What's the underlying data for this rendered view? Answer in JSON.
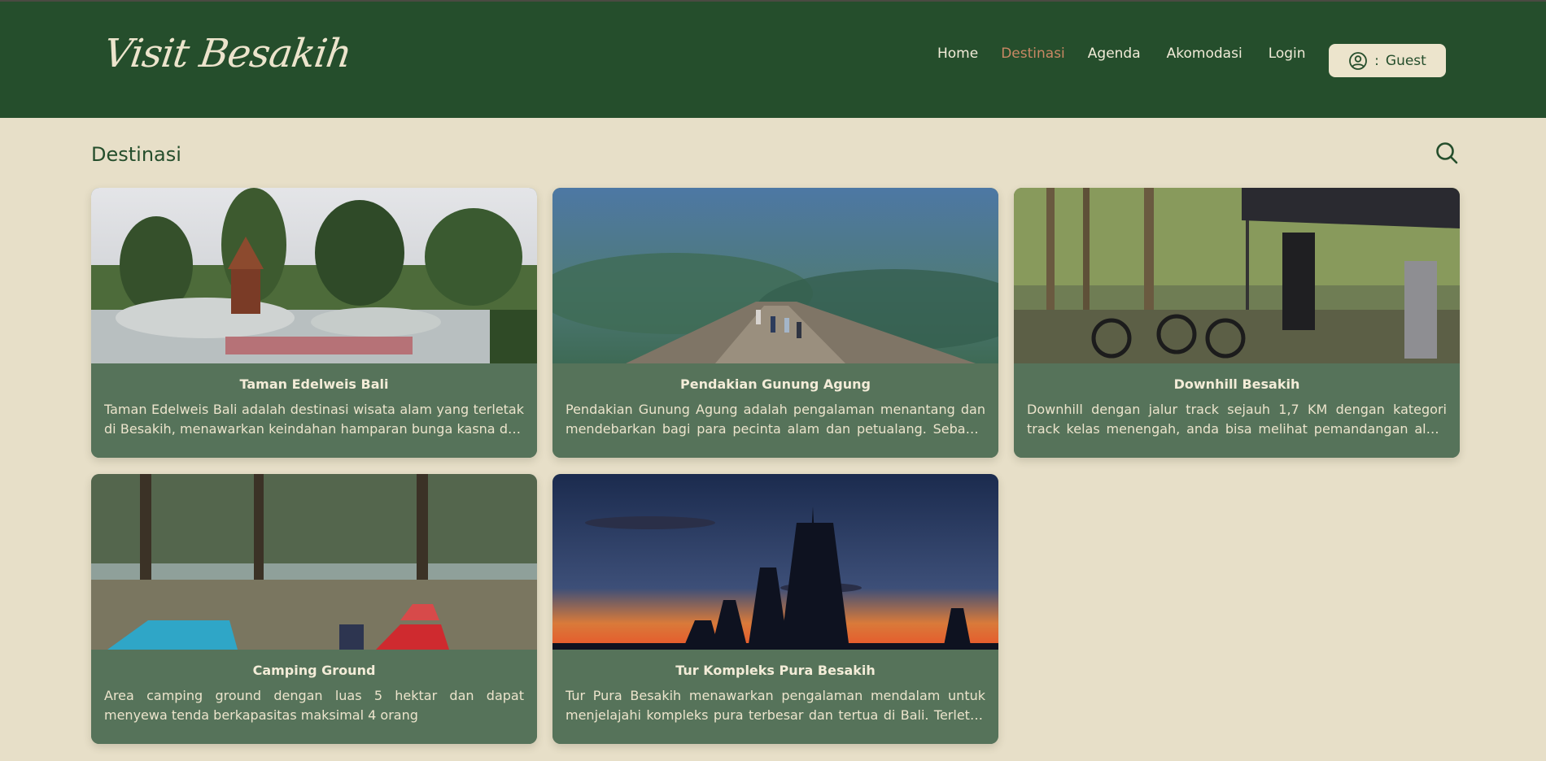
{
  "header": {
    "logo": "Visit Besakih",
    "nav": [
      {
        "label": "Home",
        "active": false
      },
      {
        "label": "Destinasi",
        "active": true
      },
      {
        "label": "Agenda",
        "active": false
      },
      {
        "label": "Akomodasi",
        "active": false
      },
      {
        "label": "Login",
        "active": false
      }
    ],
    "user_separator": ":",
    "user_label": "Guest",
    "user_icon": "user-circle-icon"
  },
  "main": {
    "title": "Destinasi",
    "search_icon": "search-icon",
    "cards": [
      {
        "title": "Taman Edelweis Bali",
        "description": "Taman Edelweis Bali adalah destinasi wisata alam yang terletak di Besakih, menawarkan keindahan hamparan bunga kasna dan pemandangan alam yang memukau."
      },
      {
        "title": "Pendakian Gunung Agung",
        "description": "Pendakian Gunung Agung adalah pengalaman menantang dan mendebarkan bagi para pecinta alam dan petualang. Sebagai gunung tertinggi di Bali."
      },
      {
        "title": "Downhill Besakih",
        "description": "Downhill dengan jalur track sejauh 1,7 KM dengan kategori track kelas menengah, anda bisa melihat pemandangan alam hutan pinus yang asri."
      },
      {
        "title": "Camping Ground",
        "description": "Area camping ground dengan luas 5 hektar dan dapat menyewa tenda berkapasitas maksimal 4 orang"
      },
      {
        "title": "Tur Kompleks Pura Besakih",
        "description": "Tur Pura Besakih menawarkan pengalaman mendalam untuk menjelajahi kompleks pura terbesar dan tertua di Bali. Terletak di lereng Gunung Agung."
      }
    ]
  },
  "colors": {
    "header_bg": "#254e2c",
    "page_bg": "#e7dfc8",
    "active_nav": "#c98864",
    "card_info_bg": "#56735a"
  }
}
